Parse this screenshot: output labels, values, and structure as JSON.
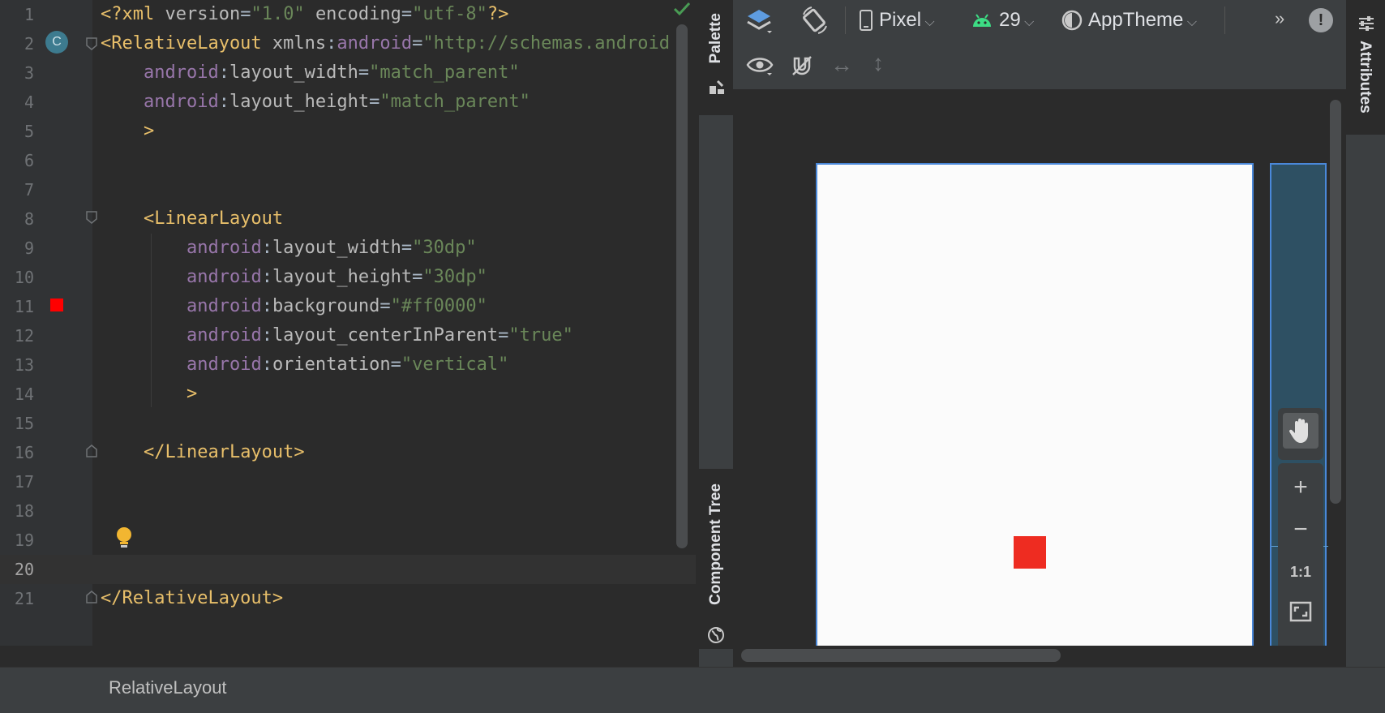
{
  "editor": {
    "lines": [
      {
        "n": "1",
        "tokens": [
          {
            "c": "t-tag",
            "t": "<?xml "
          },
          {
            "c": "t-attr",
            "t": "version"
          },
          {
            "c": "t-plain",
            "t": "="
          },
          {
            "c": "t-val",
            "t": "\"1.0\""
          },
          {
            "c": "t-plain",
            "t": " "
          },
          {
            "c": "t-attr",
            "t": "encoding"
          },
          {
            "c": "t-plain",
            "t": "="
          },
          {
            "c": "t-val",
            "t": "\"utf-8\""
          },
          {
            "c": "t-tag",
            "t": "?>"
          }
        ]
      },
      {
        "n": "2",
        "tokens": [
          {
            "c": "t-tag",
            "t": "<RelativeLayout "
          },
          {
            "c": "t-attr",
            "t": "xmlns"
          },
          {
            "c": "t-plain",
            "t": ":"
          },
          {
            "c": "t-ns",
            "t": "android"
          },
          {
            "c": "t-plain",
            "t": "="
          },
          {
            "c": "t-val",
            "t": "\"http://schemas.android"
          }
        ]
      },
      {
        "n": "3",
        "tokens": [
          {
            "c": "t-plain",
            "t": "    "
          },
          {
            "c": "t-ns",
            "t": "android"
          },
          {
            "c": "t-plain",
            "t": ":"
          },
          {
            "c": "t-attr",
            "t": "layout_width"
          },
          {
            "c": "t-plain",
            "t": "="
          },
          {
            "c": "t-val",
            "t": "\"match_parent\""
          }
        ]
      },
      {
        "n": "4",
        "tokens": [
          {
            "c": "t-plain",
            "t": "    "
          },
          {
            "c": "t-ns",
            "t": "android"
          },
          {
            "c": "t-plain",
            "t": ":"
          },
          {
            "c": "t-attr",
            "t": "layout_height"
          },
          {
            "c": "t-plain",
            "t": "="
          },
          {
            "c": "t-val",
            "t": "\"match_parent\""
          }
        ]
      },
      {
        "n": "5",
        "tokens": [
          {
            "c": "t-plain",
            "t": "    "
          },
          {
            "c": "t-tag",
            "t": ">"
          }
        ]
      },
      {
        "n": "6",
        "tokens": []
      },
      {
        "n": "7",
        "tokens": []
      },
      {
        "n": "8",
        "tokens": [
          {
            "c": "t-plain",
            "t": "    "
          },
          {
            "c": "t-tag",
            "t": "<LinearLayout"
          }
        ]
      },
      {
        "n": "9",
        "tokens": [
          {
            "c": "t-plain",
            "t": "        "
          },
          {
            "c": "t-ns",
            "t": "android"
          },
          {
            "c": "t-plain",
            "t": ":"
          },
          {
            "c": "t-attr",
            "t": "layout_width"
          },
          {
            "c": "t-plain",
            "t": "="
          },
          {
            "c": "t-val",
            "t": "\"30dp\""
          }
        ]
      },
      {
        "n": "10",
        "tokens": [
          {
            "c": "t-plain",
            "t": "        "
          },
          {
            "c": "t-ns",
            "t": "android"
          },
          {
            "c": "t-plain",
            "t": ":"
          },
          {
            "c": "t-attr",
            "t": "layout_height"
          },
          {
            "c": "t-plain",
            "t": "="
          },
          {
            "c": "t-val",
            "t": "\"30dp\""
          }
        ]
      },
      {
        "n": "11",
        "tokens": [
          {
            "c": "t-plain",
            "t": "        "
          },
          {
            "c": "t-ns",
            "t": "android"
          },
          {
            "c": "t-plain",
            "t": ":"
          },
          {
            "c": "t-attr",
            "t": "background"
          },
          {
            "c": "t-plain",
            "t": "="
          },
          {
            "c": "t-val",
            "t": "\"#ff0000\""
          }
        ]
      },
      {
        "n": "12",
        "tokens": [
          {
            "c": "t-plain",
            "t": "        "
          },
          {
            "c": "t-ns",
            "t": "android"
          },
          {
            "c": "t-plain",
            "t": ":"
          },
          {
            "c": "t-attr",
            "t": "layout_centerInParent"
          },
          {
            "c": "t-plain",
            "t": "="
          },
          {
            "c": "t-val",
            "t": "\"true\""
          }
        ]
      },
      {
        "n": "13",
        "tokens": [
          {
            "c": "t-plain",
            "t": "        "
          },
          {
            "c": "t-ns",
            "t": "android"
          },
          {
            "c": "t-plain",
            "t": ":"
          },
          {
            "c": "t-attr",
            "t": "orientation"
          },
          {
            "c": "t-plain",
            "t": "="
          },
          {
            "c": "t-val",
            "t": "\"vertical\""
          }
        ]
      },
      {
        "n": "14",
        "tokens": [
          {
            "c": "t-plain",
            "t": "        "
          },
          {
            "c": "t-tag",
            "t": ">"
          }
        ]
      },
      {
        "n": "15",
        "tokens": []
      },
      {
        "n": "16",
        "tokens": [
          {
            "c": "t-plain",
            "t": "    "
          },
          {
            "c": "t-tag",
            "t": "</LinearLayout>"
          }
        ]
      },
      {
        "n": "17",
        "tokens": []
      },
      {
        "n": "18",
        "tokens": []
      },
      {
        "n": "19",
        "tokens": []
      },
      {
        "n": "20",
        "tokens": []
      },
      {
        "n": "21",
        "tokens": [
          {
            "c": "t-tag",
            "t": "</RelativeLayout>"
          }
        ]
      }
    ],
    "current_line": "20",
    "class_marker": "C",
    "color_swatch": "#ff0000"
  },
  "side_tabs": {
    "palette": "Palette",
    "component_tree": "Component Tree",
    "attributes": "Attributes"
  },
  "toolbar": {
    "device": "Pixel",
    "api_level": "29",
    "theme": "AppTheme"
  },
  "zoom": {
    "zoom_in": "+",
    "zoom_out": "−",
    "actual_size": "1:1"
  },
  "preview": {
    "box_color": "#ee2c21"
  },
  "status": {
    "breadcrumb": "RelativeLayout"
  }
}
